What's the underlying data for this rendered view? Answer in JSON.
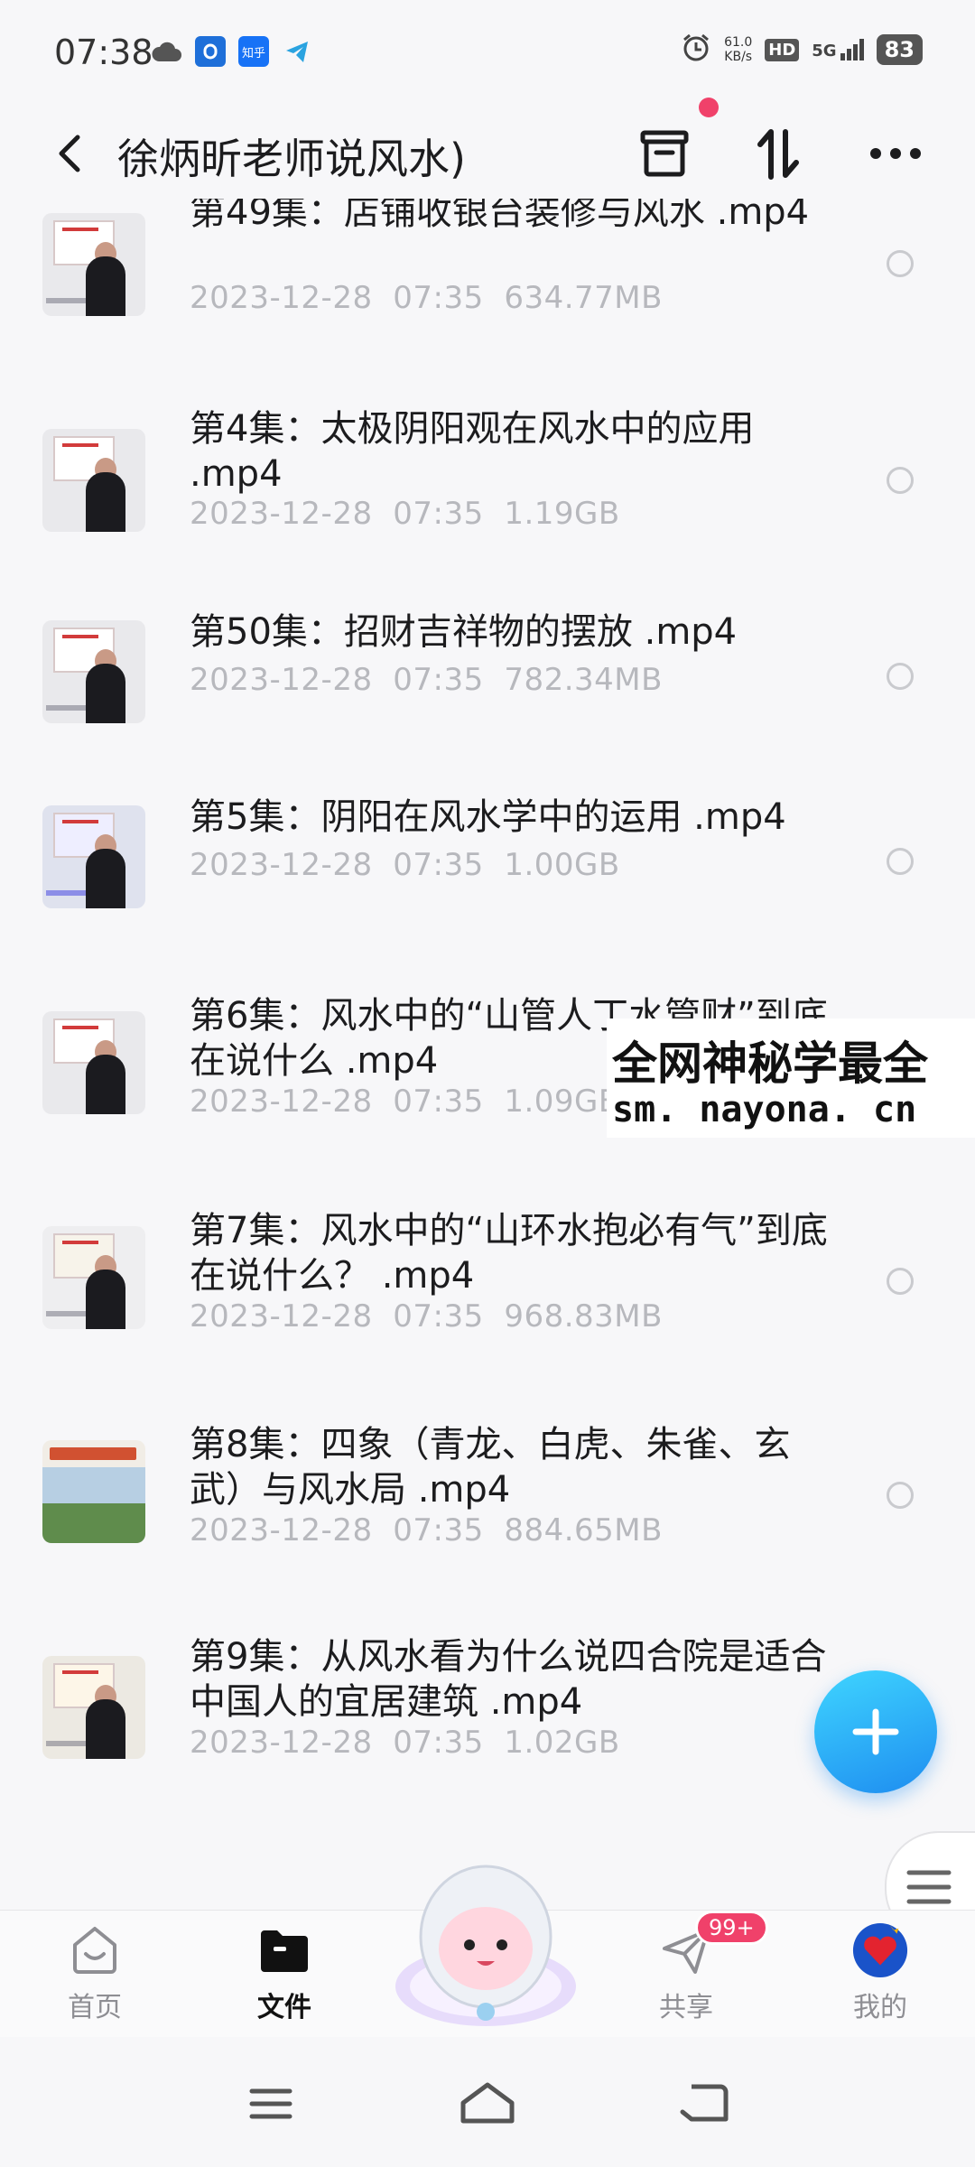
{
  "status_bar": {
    "time": "07:38",
    "net_speed_value": "61.0",
    "net_speed_unit": "KB/s",
    "hd_label": "HD",
    "network_label": "5G",
    "battery": "83",
    "app_icons": [
      "cloud-icon",
      "qq-icon",
      "zhihu-icon",
      "telegram-icon"
    ],
    "zhihu_label": "知乎"
  },
  "header": {
    "title": "徐炳昕老师说风水)"
  },
  "files": [
    {
      "title": "第49集：店铺收银台装修与风水 .mp4",
      "date": "2023-12-28",
      "time": "07:35",
      "size": "634.77MB",
      "thumb": "lecture"
    },
    {
      "title": "第4集：太极阴阳观在风水中的应用 .mp4",
      "date": "2023-12-28",
      "time": "07:35",
      "size": "1.19GB",
      "thumb": "lecture"
    },
    {
      "title": "第50集：招财吉祥物的摆放 .mp4",
      "date": "2023-12-28",
      "time": "07:35",
      "size": "782.34MB",
      "thumb": "lecture"
    },
    {
      "title": "第5集：阴阳在风水学中的运用 .mp4",
      "date": "2023-12-28",
      "time": "07:35",
      "size": "1.00GB",
      "thumb": "lecture"
    },
    {
      "title": "第6集：风水中的“山管人丁水管财”到底在说什么 .mp4",
      "date": "2023-12-28",
      "time": "07:35",
      "size": "1.09GB",
      "thumb": "lecture"
    },
    {
      "title": "第7集：风水中的“山环水抱必有气”到底在说什么？ .mp4",
      "date": "2023-12-28",
      "time": "07:35",
      "size": "968.83MB",
      "thumb": "lecture"
    },
    {
      "title": "第8集：四象（青龙、白虎、朱雀、玄武）与风水局 .mp4",
      "date": "2023-12-28",
      "time": "07:35",
      "size": "884.65MB",
      "thumb": "landscape"
    },
    {
      "title": "第9集：从风水看为什么说四合院是适合中国人的宜居建筑 .mp4",
      "date": "2023-12-28",
      "time": "07:35",
      "size": "1.02GB",
      "thumb": "lecture"
    }
  ],
  "watermark": {
    "line1": "全网神秘学最全",
    "line2": "sm. nayona. cn"
  },
  "bottom_nav": {
    "home": "首页",
    "files": "文件",
    "share": "共享",
    "share_badge": "99+",
    "mine": "我的"
  },
  "colors": {
    "accent": "#1e8df0",
    "badge": "#f0416a",
    "meta_text": "#b7b8bd"
  }
}
